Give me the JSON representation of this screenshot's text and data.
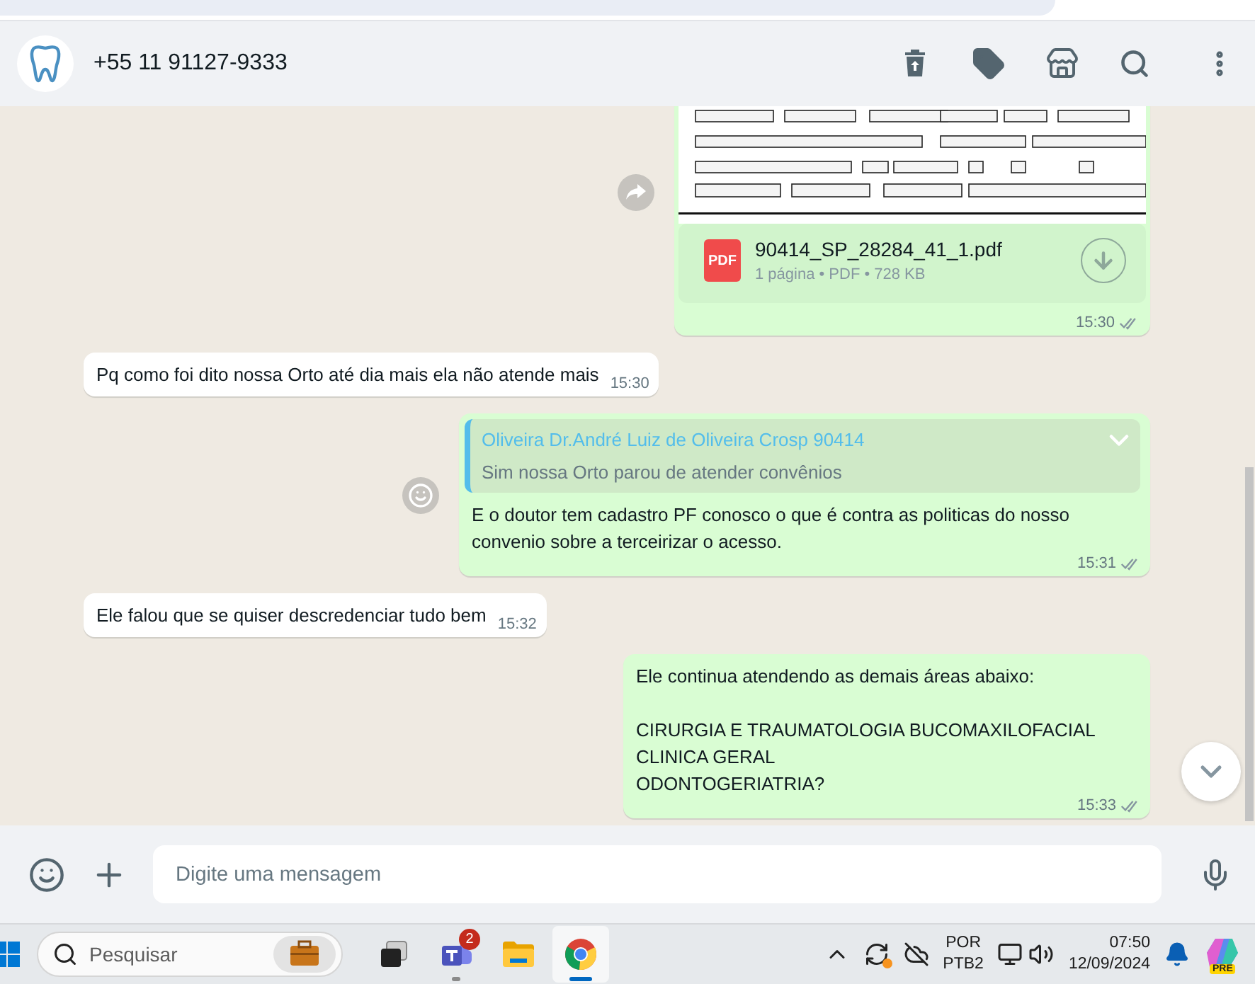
{
  "header": {
    "contact": "+55 11 91127-9333"
  },
  "messages": [
    {
      "kind": "document",
      "outgoing": true,
      "forward_button": true,
      "file_badge": "PDF",
      "file_name": "90414_SP_28284_41_1.pdf",
      "file_info": "1 página • PDF • 728 KB",
      "time": "15:30"
    },
    {
      "kind": "text",
      "outgoing": false,
      "text": "Pq como foi dito nossa Orto até dia mais ela não atende mais",
      "time": "15:30"
    },
    {
      "kind": "reply",
      "outgoing": true,
      "reaction_button": true,
      "quote_author": "Oliveira Dr.André Luiz de Oliveira Crosp 90414",
      "quote_text": "Sim nossa Orto parou de atender convênios",
      "text": "E o doutor tem cadastro PF conosco o que é contra as politicas do nosso convenio sobre a terceirizar o acesso.",
      "time": "15:31"
    },
    {
      "kind": "text",
      "outgoing": false,
      "text": "Ele falou que se quiser descredenciar tudo bem",
      "time": "15:32"
    },
    {
      "kind": "text",
      "outgoing": true,
      "text": "Ele continua atendendo as demais áreas abaixo:\n\nCIRURGIA E TRAUMATOLOGIA BUCOMAXILOFACIAL\nCLINICA GERAL\nODONTOGERIATRIA?",
      "time": "15:33"
    }
  ],
  "composer": {
    "placeholder": "Digite uma mensagem"
  },
  "taskbar": {
    "search_placeholder": "Pesquisar",
    "apps": [
      {
        "kind": "taskview",
        "selected": false,
        "running": false
      },
      {
        "kind": "teams",
        "badge": "2",
        "selected": false,
        "running": true
      },
      {
        "kind": "explorer",
        "selected": false,
        "running": false
      },
      {
        "kind": "chrome",
        "selected": true,
        "running": true
      }
    ],
    "language": "POR",
    "layout": "PTB2",
    "time": "07:50",
    "date": "12/09/2024",
    "copilot_badge": "PRE"
  }
}
